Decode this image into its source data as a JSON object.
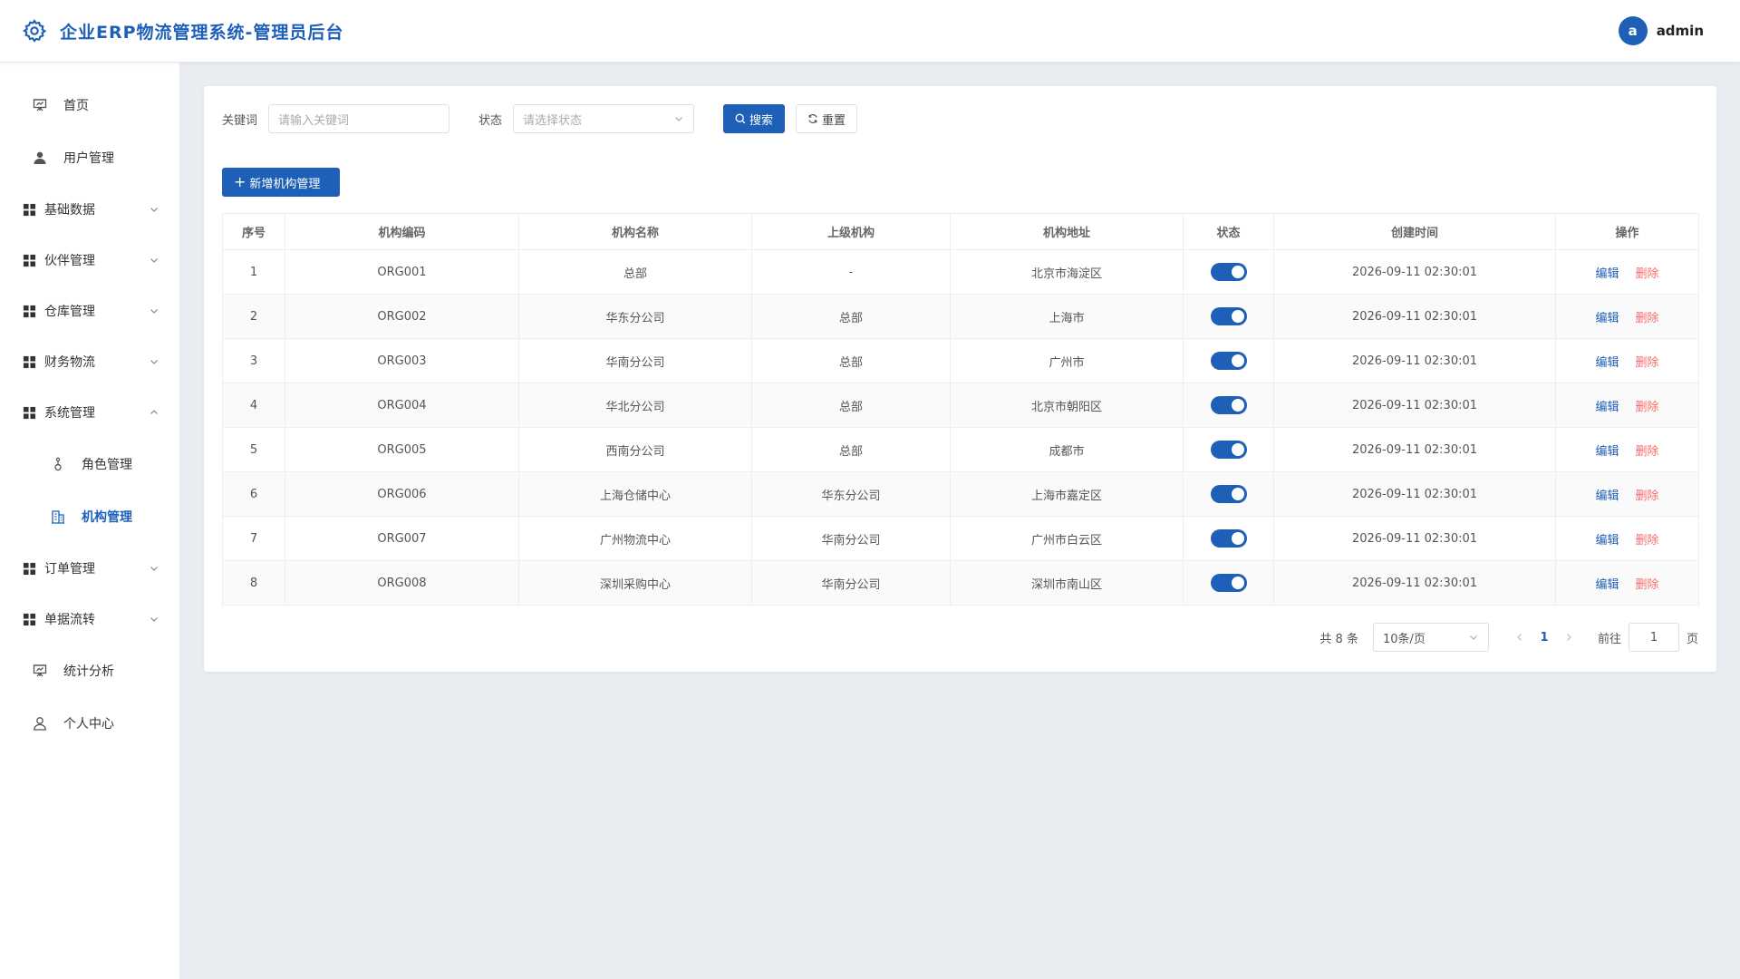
{
  "header": {
    "title": "企业ERP物流管理系统-管理员后台",
    "avatar_letter": "a",
    "username": "admin"
  },
  "sidebar": {
    "items": [
      {
        "label": "首页",
        "icon": "dashboard-icon"
      },
      {
        "label": "用户管理",
        "icon": "user-icon"
      },
      {
        "label": "基础数据",
        "icon": "grid-icon",
        "expanded": false
      },
      {
        "label": "伙伴管理",
        "icon": "grid-icon",
        "expanded": false
      },
      {
        "label": "仓库管理",
        "icon": "grid-icon",
        "expanded": false
      },
      {
        "label": "财务物流",
        "icon": "grid-icon",
        "expanded": false
      },
      {
        "label": "系统管理",
        "icon": "grid-icon",
        "expanded": true
      },
      {
        "label": "角色管理",
        "icon": "role-icon"
      },
      {
        "label": "机构管理",
        "icon": "building-icon",
        "active": true
      },
      {
        "label": "订单管理",
        "icon": "grid-icon",
        "expanded": false
      },
      {
        "label": "单据流转",
        "icon": "grid-icon",
        "expanded": false
      },
      {
        "label": "统计分析",
        "icon": "chart-board-icon"
      },
      {
        "label": "个人中心",
        "icon": "person-icon"
      }
    ]
  },
  "filters": {
    "keyword_label": "关键词",
    "keyword_placeholder": "请输入关键词",
    "status_label": "状态",
    "status_placeholder": "请选择状态",
    "search_label": "搜索",
    "reset_label": "重置"
  },
  "add_button_label": "新增机构管理",
  "table": {
    "columns": [
      "序号",
      "机构编码",
      "机构名称",
      "上级机构",
      "机构地址",
      "状态",
      "创建时间",
      "操作"
    ],
    "rows": [
      {
        "no": "1",
        "code": "ORG001",
        "name": "总部",
        "parent": "-",
        "address": "北京市海淀区",
        "status": true,
        "created": "2026-09-11 02:30:01"
      },
      {
        "no": "2",
        "code": "ORG002",
        "name": "华东分公司",
        "parent": "总部",
        "address": "上海市",
        "status": true,
        "created": "2026-09-11 02:30:01"
      },
      {
        "no": "3",
        "code": "ORG003",
        "name": "华南分公司",
        "parent": "总部",
        "address": "广州市",
        "status": true,
        "created": "2026-09-11 02:30:01"
      },
      {
        "no": "4",
        "code": "ORG004",
        "name": "华北分公司",
        "parent": "总部",
        "address": "北京市朝阳区",
        "status": true,
        "created": "2026-09-11 02:30:01"
      },
      {
        "no": "5",
        "code": "ORG005",
        "name": "西南分公司",
        "parent": "总部",
        "address": "成都市",
        "status": true,
        "created": "2026-09-11 02:30:01"
      },
      {
        "no": "6",
        "code": "ORG006",
        "name": "上海仓储中心",
        "parent": "华东分公司",
        "address": "上海市嘉定区",
        "status": true,
        "created": "2026-09-11 02:30:01"
      },
      {
        "no": "7",
        "code": "ORG007",
        "name": "广州物流中心",
        "parent": "华南分公司",
        "address": "广州市白云区",
        "status": true,
        "created": "2026-09-11 02:30:01"
      },
      {
        "no": "8",
        "code": "ORG008",
        "name": "深圳采购中心",
        "parent": "华南分公司",
        "address": "深圳市南山区",
        "status": true,
        "created": "2026-09-11 02:30:01"
      }
    ],
    "edit_label": "编辑",
    "delete_label": "删除"
  },
  "pagination": {
    "total": "共 8 条",
    "page_size": "10条/页",
    "current_page": "1",
    "goto_label": "前往",
    "goto_value": "1",
    "page_suffix": "页"
  },
  "colors": {
    "primary": "#1e5fb8",
    "danger": "#f56c6c",
    "background": "#e9ecf1"
  }
}
